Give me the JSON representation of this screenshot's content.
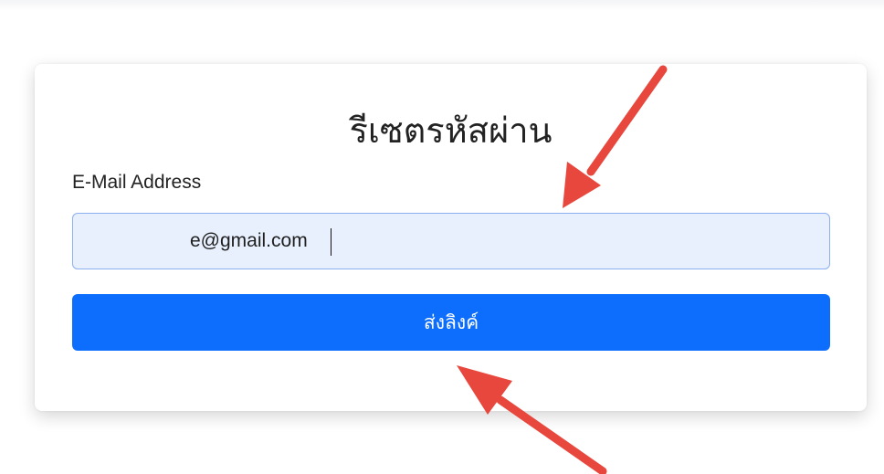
{
  "form": {
    "title": "รีเซตรหัสผ่าน",
    "email_label": "E-Mail Address",
    "email_value": "e@gmail.com",
    "submit_label": "ส่งลิงค์"
  },
  "colors": {
    "primary_button": "#0d6efd",
    "input_background": "#e8f0fe",
    "input_border": "#8cb0f0",
    "annotation_arrow": "#e8473e"
  },
  "annotations": [
    {
      "name": "arrow-to-email-input"
    },
    {
      "name": "arrow-to-submit-button"
    }
  ]
}
